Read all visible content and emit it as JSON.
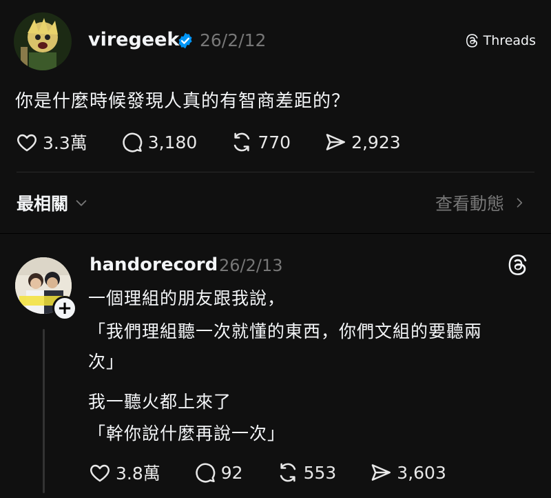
{
  "post": {
    "username": "viregeek",
    "date": "26/2/12",
    "brand_label": "Threads",
    "text": "你是什麼時候發現人真的有智商差距的？",
    "actions": {
      "likes": "3.3萬",
      "comments": "3,180",
      "reposts": "770",
      "shares": "2,923"
    }
  },
  "sort": {
    "label": "最相關",
    "activity_label": "查看動態"
  },
  "reply": {
    "username": "handorecord",
    "date": "26/2/13",
    "lines": [
      "一個理組的朋友跟我說，",
      "「我們理組聽一次就懂的東西，你們文組的要聽兩",
      "次」",
      "我一聽火都上來了",
      "「幹你說什麼再說一次」"
    ],
    "actions": {
      "likes": "3.8萬",
      "comments": "92",
      "reposts": "553",
      "shares": "3,603"
    }
  },
  "colors": {
    "background": "#101010",
    "text": "#f3f5f7",
    "muted": "#777777",
    "verified": "#0095f6"
  },
  "icons": [
    "heart-icon",
    "comment-icon",
    "repost-icon",
    "share-icon",
    "threads-logo-icon",
    "verified-badge-icon",
    "chevron-down-icon",
    "chevron-right-icon",
    "plus-icon"
  ]
}
